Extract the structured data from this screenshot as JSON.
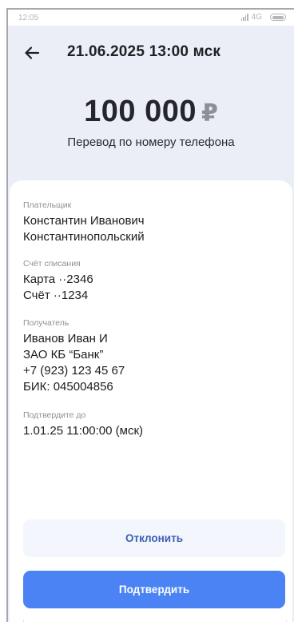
{
  "status_bar": {
    "time": "12:05",
    "network": "4G",
    "icons": [
      "signal-icon",
      "battery-icon"
    ]
  },
  "header": {
    "back_icon": "arrow-left-icon",
    "title": "21.06.2025 13:00 мск"
  },
  "amount": {
    "value": "100 000",
    "currency": "₽",
    "subtitle": "Перевод по номеру телефона"
  },
  "details": {
    "payer": {
      "label": "Плательщик",
      "lines": [
        "Константин Иванович",
        "Константинопольский"
      ]
    },
    "debit_account": {
      "label": "Счёт списания",
      "lines": [
        "Карта ··2346",
        "Счёт ··1234"
      ]
    },
    "recipient": {
      "label": "Получатель",
      "lines": [
        "Иванов Иван И",
        "ЗАО КБ “Банк”",
        "+7 (923) 123 45 67",
        "БИК: 045004856"
      ]
    },
    "confirm_until": {
      "label": "Подтвердите до",
      "lines": [
        "1.01.25 11:00:00 (мск)"
      ]
    }
  },
  "actions": {
    "decline_label": "Отклонить",
    "confirm_label": "Подтвердить"
  },
  "colors": {
    "background": "#ebeef6",
    "accent": "#4b83f5",
    "secondary_button": "#f3f6fd",
    "secondary_text": "#3c5fb6",
    "label_gray": "#8e9098"
  }
}
